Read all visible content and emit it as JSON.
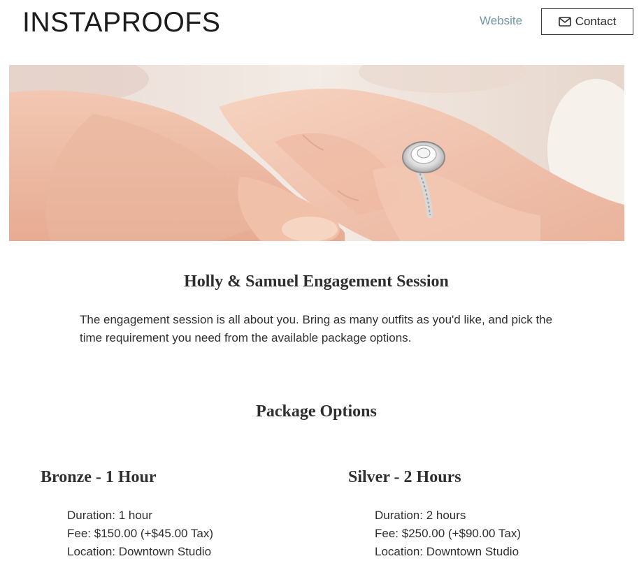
{
  "header": {
    "logo_text": "INSTAPROOFS",
    "website_link": "Website",
    "contact_button": "Contact",
    "contact_icon": "envelope-icon",
    "website_color": "#6e97a6"
  },
  "hero": {
    "image_alt": "engagement-ring-hands-photo"
  },
  "session": {
    "title": "Holly & Samuel Engagement Session",
    "description": "The engagement session is all about you. Bring as many outfits as you'd like, and pick the time requirement you need from the available package options."
  },
  "packages": {
    "heading": "Package Options",
    "items": [
      {
        "name": "Bronze - 1 Hour",
        "duration": "Duration: 1 hour",
        "fee": "Fee: $150.00 (+$45.00 Tax)",
        "location": "Location: Downtown Studio"
      },
      {
        "name": "Silver - 2 Hours",
        "duration": "Duration: 2 hours",
        "fee": "Fee: $250.00 (+$90.00 Tax)",
        "location": "Location: Downtown Studio"
      }
    ]
  }
}
